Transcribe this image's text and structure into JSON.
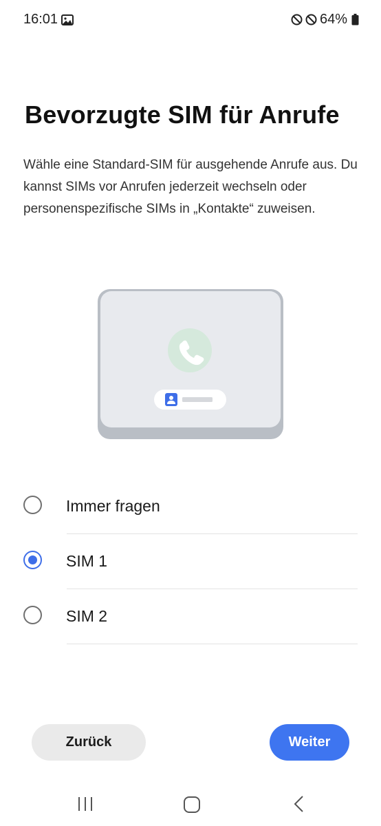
{
  "status_bar": {
    "time": "16:01",
    "battery": "64%",
    "icons": [
      "gallery-icon",
      "no-sim-icon",
      "no-sim-icon",
      "battery-icon"
    ]
  },
  "title": "Bevorzugte SIM für Anrufe",
  "description": "Wähle eine Standard-SIM für ausgehende Anrufe aus. Du kannst SIMs vor Anrufen jederzeit wechseln oder personenspezifische SIMs in „Kontakte“ zuweisen.",
  "illustration": {
    "icons": [
      "phone-call-icon",
      "contact-icon"
    ]
  },
  "options": [
    {
      "label": "Immer fragen",
      "selected": false
    },
    {
      "label": "SIM 1",
      "selected": true
    },
    {
      "label": "SIM 2",
      "selected": false
    }
  ],
  "buttons": {
    "back": "Zurück",
    "next": "Weiter"
  },
  "nav_bar": {
    "icons": [
      "recents-icon",
      "home-icon",
      "back-icon"
    ]
  },
  "colors": {
    "accent": "#3e75f0",
    "radio_selected": "#3e6ee8",
    "phone_circle": "#d5e9dc"
  }
}
